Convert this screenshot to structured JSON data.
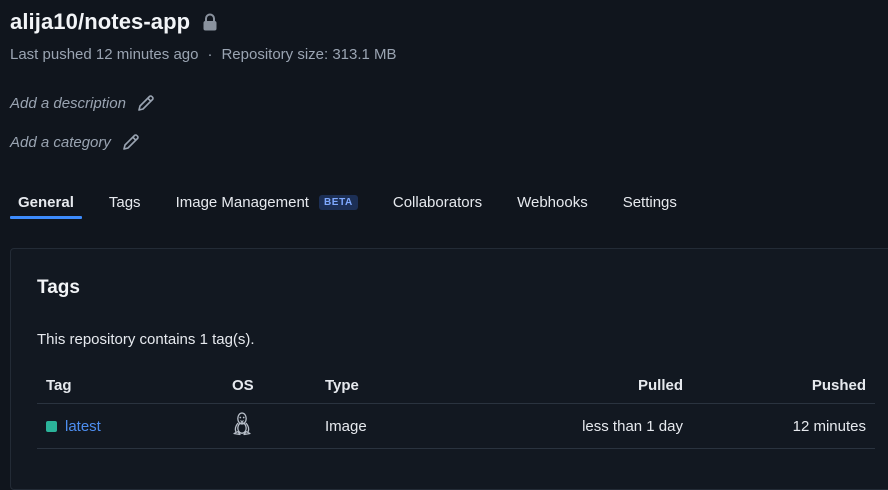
{
  "repo": {
    "title": "alija10/notes-app",
    "last_pushed": "Last pushed 12 minutes ago",
    "separator": "·",
    "size": "Repository size: 313.1 MB",
    "add_description": "Add a description",
    "add_category": "Add a category",
    "lock_icon": "lock-icon",
    "edit_icon": "pencil-icon"
  },
  "tabs": [
    {
      "label": "General",
      "active": true
    },
    {
      "label": "Tags"
    },
    {
      "label": "Image Management",
      "badge": "BETA"
    },
    {
      "label": "Collaborators"
    },
    {
      "label": "Webhooks"
    },
    {
      "label": "Settings"
    }
  ],
  "tags_panel": {
    "title": "Tags",
    "summary": "This repository contains 1 tag(s).",
    "columns": {
      "tag": "Tag",
      "os": "OS",
      "type": "Type",
      "pulled": "Pulled",
      "pushed": "Pushed"
    },
    "rows": [
      {
        "tag": "latest",
        "os_icon": "linux-icon",
        "type": "Image",
        "pulled": "less than 1 day",
        "pushed": "12 minutes"
      }
    ]
  },
  "colors": {
    "background": "#10151d",
    "accent": "#3d8bfd",
    "link": "#4d8ef0",
    "status_active": "#2bb39a"
  }
}
